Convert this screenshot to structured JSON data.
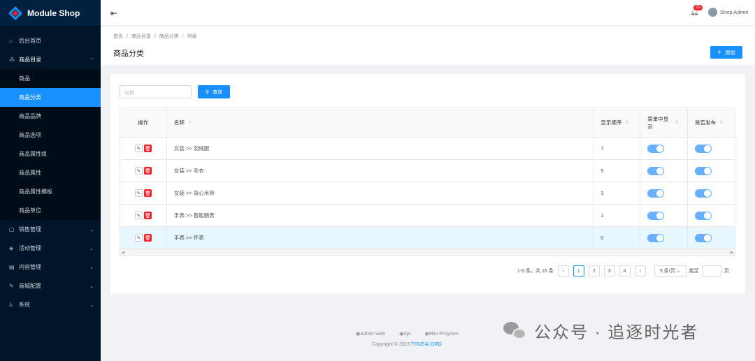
{
  "app": {
    "title": "Module Shop"
  },
  "sidebar": {
    "items": [
      {
        "label": "后台首页",
        "icon": "home-icon"
      },
      {
        "label": "商品目录",
        "icon": "cluster-icon"
      },
      {
        "label": "销售管理",
        "icon": "bag-icon"
      },
      {
        "label": "活动管理",
        "icon": "tag-icon"
      },
      {
        "label": "内容管理",
        "icon": "content-icon"
      },
      {
        "label": "商城配置",
        "icon": "wrench-icon"
      },
      {
        "label": "系统",
        "icon": "system-icon"
      }
    ],
    "submenu": [
      "商品",
      "商品分类",
      "商品品牌",
      "商品选项",
      "商品属性组",
      "商品属性",
      "商品属性模板",
      "商品单位"
    ]
  },
  "header": {
    "notification_count": "20",
    "user_name": "Shop Admin"
  },
  "breadcrumb": [
    "首页",
    "/",
    "商品目录",
    "/",
    "商品分类",
    "/",
    "列表"
  ],
  "page": {
    "title": "商品分类",
    "add_label": "添加"
  },
  "search": {
    "placeholder": "名称",
    "button_label": "查询"
  },
  "table": {
    "columns": [
      "操作",
      "名称",
      "显示顺序",
      "菜单中显示",
      "是否发布"
    ],
    "rows": [
      {
        "name": "女装 >> 羽绒服",
        "order": "7"
      },
      {
        "name": "女装 >> 毛衣",
        "order": "5"
      },
      {
        "name": "女装 >> 背心吊带",
        "order": "3"
      },
      {
        "name": "手表 >> 智能腕表",
        "order": "1"
      },
      {
        "name": "手表 >> 怀表",
        "order": "0"
      }
    ]
  },
  "pagination": {
    "summary": "1-5 条，共 16 条",
    "pages": [
      "1",
      "2",
      "3",
      "4"
    ],
    "page_size": "5 条/页",
    "jump_label": "跳至",
    "page_unit": "页"
  },
  "footer": {
    "links": [
      "Admin Web",
      "Api",
      "Mini Program"
    ],
    "copyright": "Copyright © 2019",
    "org": "TRUEAI.ORG"
  },
  "watermark": {
    "text": "公众号 · 追逐时光者"
  },
  "colors": {
    "primary": "#1890ff",
    "sidebar": "#001529",
    "danger": "#f5222d"
  }
}
